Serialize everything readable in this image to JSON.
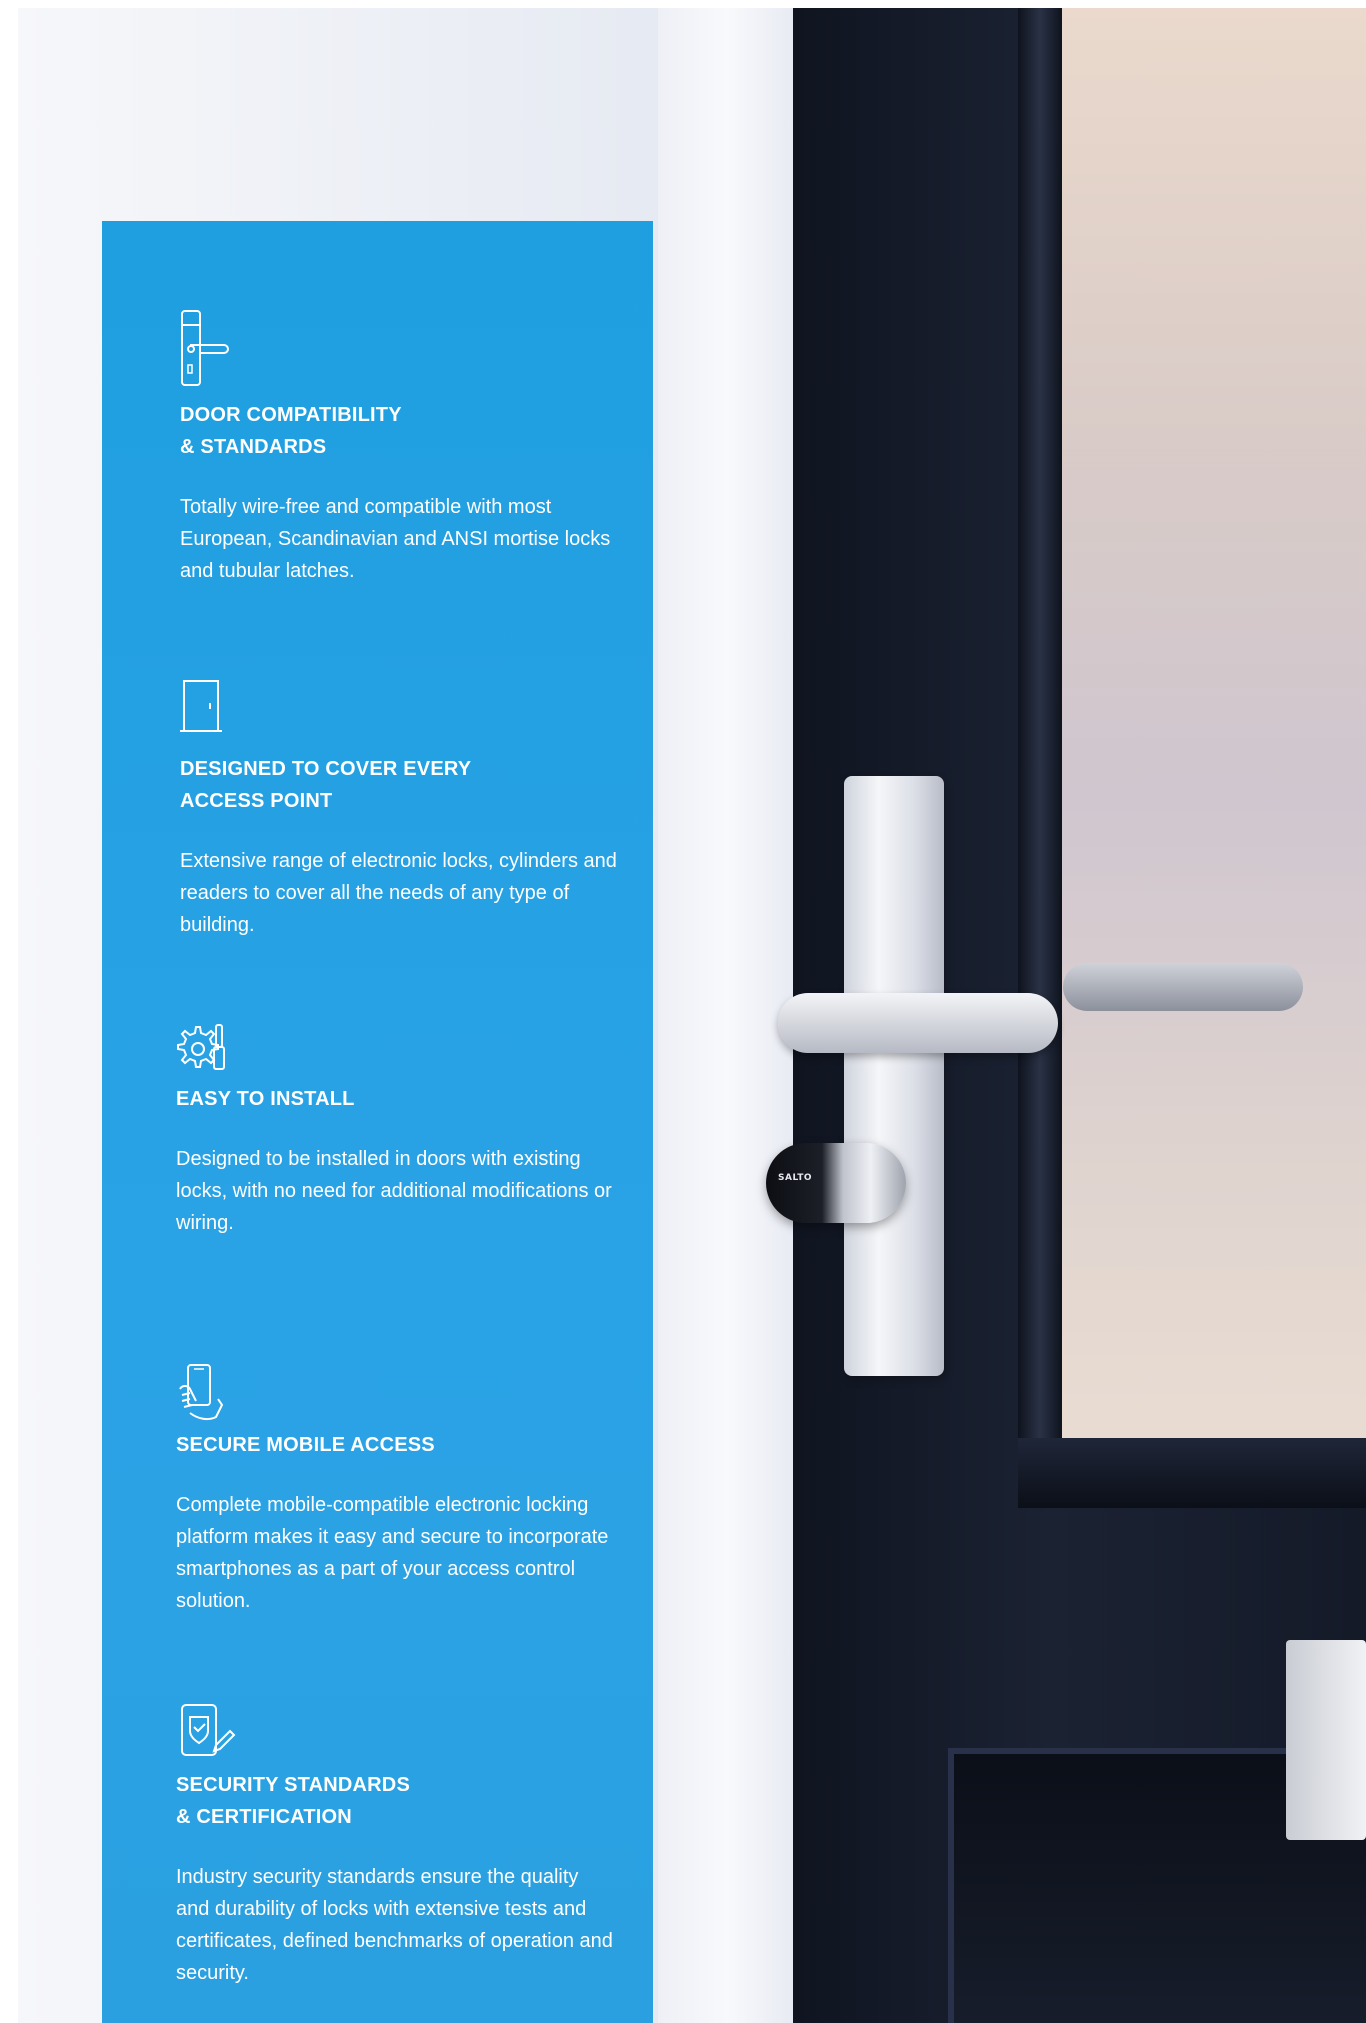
{
  "features": [
    {
      "icon": "door-handle-icon",
      "title_line1": "DOOR COMPATIBILITY",
      "title_line2": "& STANDARDS",
      "description": "Totally wire-free and compatible with most European, Scandinavian and ANSI mortise locks and tubular latches."
    },
    {
      "icon": "door-icon",
      "title_line1": "DESIGNED TO COVER EVERY",
      "title_line2": "ACCESS POINT",
      "description": "Extensive range of electronic locks, cylinders and readers to cover all the needs of any type of building."
    },
    {
      "icon": "gear-screwdriver-icon",
      "title_line1": "EASY TO INSTALL",
      "title_line2": "",
      "description": "Designed to be installed in doors with existing locks, with no need for additional modifications or wiring."
    },
    {
      "icon": "hand-smartphone-icon",
      "title_line1": "SECURE MOBILE ACCESS",
      "title_line2": "",
      "description": "Complete mobile-compatible electronic locking platform makes it easy and secure to incorporate smartphones as a part of your access control solution."
    },
    {
      "icon": "certified-document-icon",
      "title_line1": "SECURITY STANDARDS",
      "title_line2": "& CERTIFICATION",
      "description": "Industry security standards ensure the quality and durability of locks with extensive tests and certificates, defined benchmarks of operation and security."
    }
  ],
  "photo": {
    "cylinder_brand": "SALTO"
  },
  "colors": {
    "card_blue": "#1f9fe0",
    "text": "#ffffff",
    "door_dark": "#141a28"
  }
}
